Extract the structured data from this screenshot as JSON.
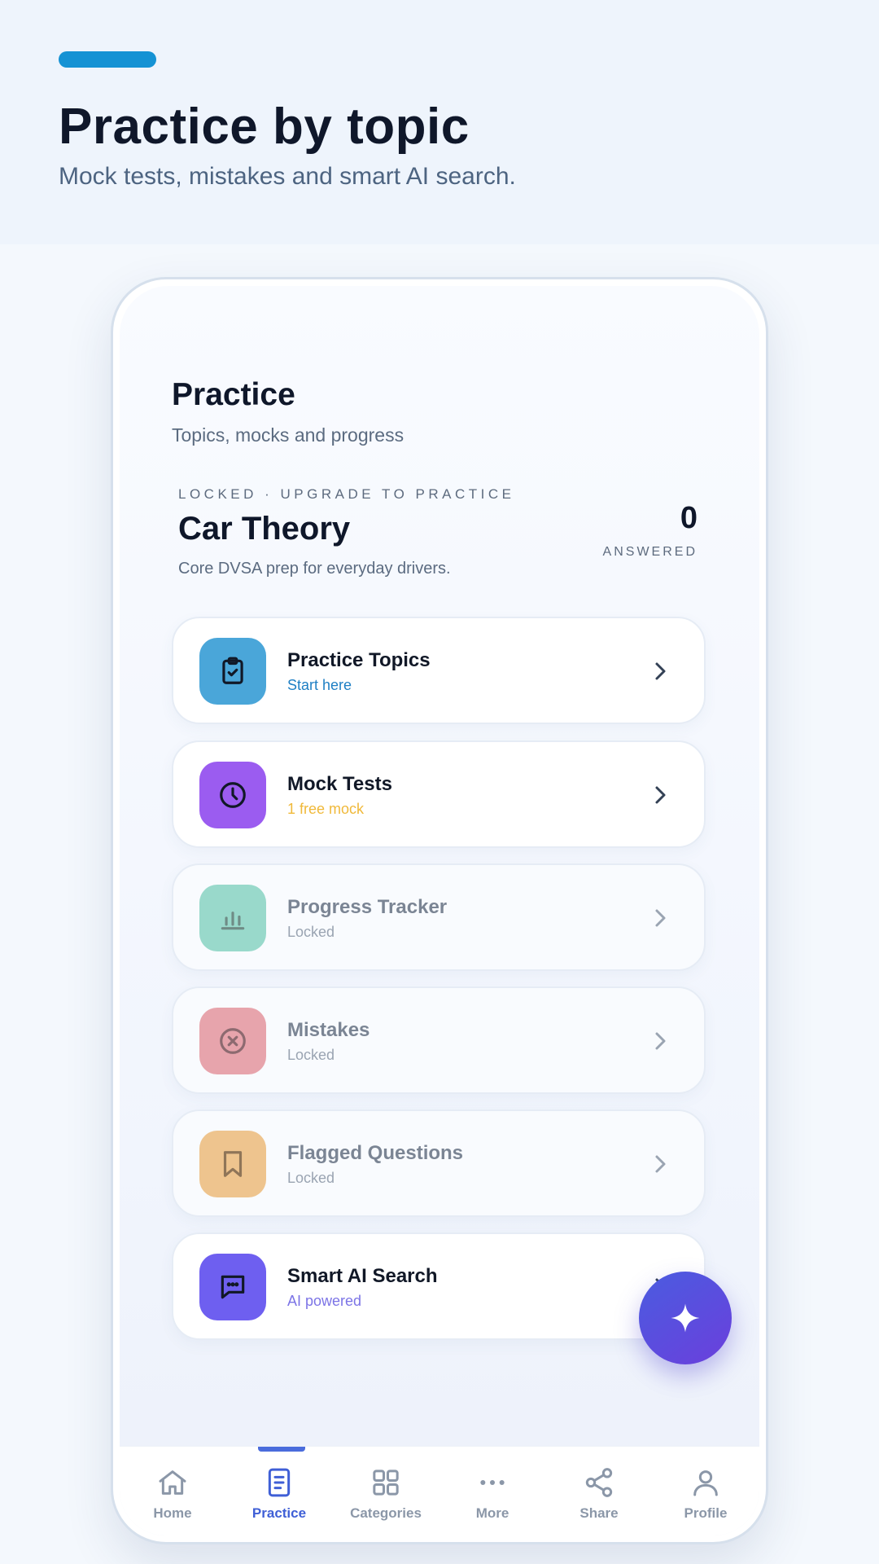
{
  "header": {
    "title": "Practice by topic",
    "subtitle": "Mock tests, mistakes and smart AI search."
  },
  "screen": {
    "title": "Practice",
    "subtitle": "Topics, mocks and progress"
  },
  "course": {
    "status": "LOCKED · UPGRADE TO PRACTICE",
    "name": "Car Theory",
    "description": "Core DVSA prep for everyday drivers.",
    "answered_count": "0",
    "answered_label": "ANSWERED"
  },
  "menu": [
    {
      "title": "Practice Topics",
      "status": "Start here",
      "status_color": "#1e7fc4",
      "icon": "clipboard-check-icon",
      "icon_bg": "#4aa6d9",
      "locked": false
    },
    {
      "title": "Mock Tests",
      "status": "1 free mock",
      "status_color": "#f0b93a",
      "icon": "clock-icon",
      "icon_bg": "#9b5cf0",
      "locked": false
    },
    {
      "title": "Progress Tracker",
      "status": "Locked",
      "status_color": "#9aa4b2",
      "icon": "bar-chart-icon",
      "icon_bg": "#99d9cb",
      "locked": true
    },
    {
      "title": "Mistakes",
      "status": "Locked",
      "status_color": "#9aa4b2",
      "icon": "x-circle-icon",
      "icon_bg": "#e7a4ac",
      "locked": true
    },
    {
      "title": "Flagged Questions",
      "status": "Locked",
      "status_color": "#9aa4b2",
      "icon": "bookmark-icon",
      "icon_bg": "#eec48e",
      "locked": true
    },
    {
      "title": "Smart AI Search",
      "status": "AI powered",
      "status_color": "#7c74e6",
      "icon": "chat-bubble-icon",
      "icon_bg": "#6e5ff0",
      "locked": false
    }
  ],
  "fab": {
    "icon": "sparkle-icon"
  },
  "nav": {
    "items": [
      {
        "label": "Home",
        "icon": "home-icon"
      },
      {
        "label": "Practice",
        "icon": "document-icon",
        "active": true
      },
      {
        "label": "Categories",
        "icon": "grid-icon"
      },
      {
        "label": "More",
        "icon": "more-dots-icon"
      },
      {
        "label": "Share",
        "icon": "share-icon"
      },
      {
        "label": "Profile",
        "icon": "user-icon"
      }
    ]
  },
  "colors": {
    "accent": "#1592d4",
    "nav_active": "#3f5fd6",
    "nav_inactive": "#8b97a8",
    "fab_start": "#4a5ce0",
    "fab_end": "#6b3fdc"
  }
}
